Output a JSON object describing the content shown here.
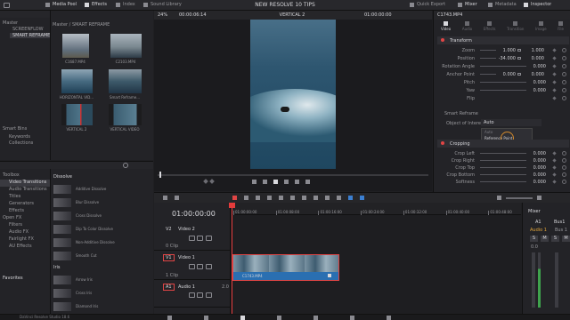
{
  "toolbar": {
    "media_pool": "Media Pool",
    "effects": "Effects",
    "index": "Index",
    "sound_library": "Sound Library",
    "project_title": "NEW RESOLVE 10 TIPS",
    "quick_export": "Quick Export",
    "mixer": "Mixer",
    "metadata": "Metadata",
    "inspector": "Inspector"
  },
  "viewer": {
    "zoom": "24%",
    "timecode_left": "00:00:06:14",
    "timeline_name": "VERTICAL 2",
    "timecode_right": "01:00:00:00"
  },
  "media_pool": {
    "tree": [
      {
        "label": "Master"
      },
      {
        "label": "SCREENFLOW"
      },
      {
        "label": "SMART REFRAME"
      }
    ],
    "breadcrumb": "Master / SMART REFRAME",
    "clips": [
      {
        "name": "C1687.MP4"
      },
      {
        "name": "C2103.MP4"
      },
      {
        "name": "HORIZONTAL VID..."
      },
      {
        "name": "Smart Reframe..."
      },
      {
        "name": "VERTICAL 2"
      },
      {
        "name": "VERTICAL VIDEO"
      }
    ],
    "smart_bins": [
      {
        "label": "Smart Bins"
      },
      {
        "label": "Keywords"
      },
      {
        "label": "Collections"
      }
    ]
  },
  "effects": {
    "toolbox_items": [
      {
        "label": "Toolbox"
      },
      {
        "label": "Video Transitions"
      },
      {
        "label": "Audio Transitions"
      },
      {
        "label": "Titles"
      },
      {
        "label": "Generators"
      },
      {
        "label": "Effects"
      },
      {
        "label": "Open FX"
      },
      {
        "label": "Filters"
      },
      {
        "label": "Audio FX"
      },
      {
        "label": "Fairlight FX"
      },
      {
        "label": "AU Effects"
      }
    ],
    "favorites": "Favorites",
    "dissolve_header": "Dissolve",
    "dissolves": [
      {
        "label": "Additive Dissolve"
      },
      {
        "label": "Blur Dissolve"
      },
      {
        "label": "Cross Dissolve"
      },
      {
        "label": "Dip To Color Dissolve"
      },
      {
        "label": "Non-Additive Dissolve"
      },
      {
        "label": "Smooth Cut"
      }
    ],
    "iris_header": "Iris",
    "iris": [
      {
        "label": "Arrow Iris"
      },
      {
        "label": "Cross Iris"
      },
      {
        "label": "Diamond Iris"
      }
    ]
  },
  "timeline": {
    "timecode": "01:00:00:00",
    "ruler": [
      "01:00:00:00",
      "01:00:08:00",
      "01:00:16:00",
      "01:00:24:00",
      "01:00:32:00",
      "01:00:40:00",
      "01:00:48:00"
    ],
    "tracks": [
      {
        "id": "V2",
        "name": "Video 2",
        "clips": "0 Clip"
      },
      {
        "id": "V1",
        "name": "Video 1",
        "clips": "1 Clip"
      },
      {
        "id": "A1",
        "name": "Audio 1",
        "channel": "2.0"
      }
    ],
    "clip_name": "C1743.MP4"
  },
  "inspector": {
    "clip_name": "C1743.MP4",
    "tabs": [
      {
        "label": "Video"
      },
      {
        "label": "Audio"
      },
      {
        "label": "Effects"
      },
      {
        "label": "Transition"
      },
      {
        "label": "Image"
      },
      {
        "label": "File"
      }
    ],
    "transform_header": "Transform",
    "transform": [
      {
        "label": "Zoom",
        "x": "1.000",
        "y": "1.000"
      },
      {
        "label": "Position",
        "x": "-34.000",
        "y": "0.000"
      },
      {
        "label": "Rotation Angle",
        "x": "0.000"
      },
      {
        "label": "Anchor Point",
        "x": "0.000",
        "y": "0.000"
      },
      {
        "label": "Pitch",
        "x": "0.000"
      },
      {
        "label": "Yaw",
        "x": "0.000"
      },
      {
        "label": "Flip",
        "x": ""
      }
    ],
    "smart_reframe_header": "Smart Reframe",
    "object_label": "Object of Interest",
    "object_value": "Auto",
    "dropdown_options": [
      "Auto",
      "Reference Point"
    ],
    "cropping_header": "Cropping",
    "cropping": [
      {
        "label": "Crop Left",
        "x": "0.000"
      },
      {
        "label": "Crop Right",
        "x": "0.000"
      },
      {
        "label": "Crop Top",
        "x": "0.000"
      },
      {
        "label": "Crop Bottom",
        "x": "0.000"
      },
      {
        "label": "Softness",
        "x": "0.000"
      }
    ]
  },
  "mixer": {
    "title": "Mixer",
    "channels": [
      {
        "label": "A1",
        "output": "Audio 1"
      },
      {
        "label": "Bus1",
        "output": "Bus 1"
      }
    ],
    "buttons": [
      "S",
      "M",
      "S",
      "M"
    ],
    "meter": "0.0"
  },
  "status": {
    "app_name": "DaVinci Resolve Studio 18.6"
  },
  "colors": {
    "accent_red": "#e04545",
    "accent_blue": "#3b7fd1",
    "playhead": "#e43b3b",
    "clip_blue": "#2a6fb1",
    "focus_ring": "#d48a2c"
  }
}
